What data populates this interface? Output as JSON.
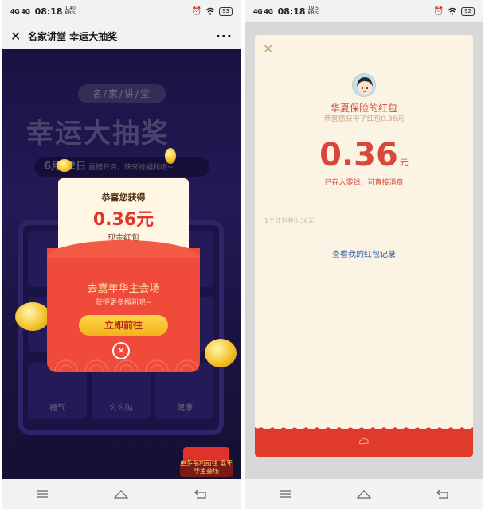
{
  "left": {
    "status": {
      "signal": "4G 4G",
      "time": "08:18",
      "speed_top": "1.40",
      "speed_bottom": "KB/s",
      "battery": "93"
    },
    "titlebar": {
      "title": "名家讲堂 幸运大抽奖"
    },
    "background": {
      "subtitle": "名/家/讲/堂",
      "title": "幸运大抽奖",
      "date_big": "6月22日",
      "date_text": "重磅开启，快来抢福利吧~",
      "cells": [
        "福气",
        "么么哒",
        "健康"
      ],
      "corner_promo": "更多福利前往 嘉年华主会场"
    },
    "popup": {
      "congrats": "恭喜您获得",
      "amount": "0.36元",
      "type": "现金红包",
      "goto": "去嘉年华主会场",
      "more": "获得更多福利吧~",
      "button": "立即前往"
    }
  },
  "right": {
    "status": {
      "signal": "4G 4G",
      "time": "08:18",
      "speed_top": "19.5",
      "speed_bottom": "KB/s",
      "battery": "92"
    },
    "card": {
      "sender": "华夏保险的红包",
      "note": "恭喜您获得了红包0.36元",
      "amount": "0.36",
      "unit": "元",
      "deposit": "已存入零钱，可直接消费",
      "count": "1个红包共0.36元",
      "record_link": "查看我的红包记录"
    }
  },
  "colors": {
    "red": "#e03a2c",
    "gold": "#f4b21b",
    "purple": "#3b2a8c",
    "cream": "#fbf3e4",
    "link": "#2b5aa0"
  },
  "icons": [
    "close-icon",
    "more-icon",
    "alarm-icon",
    "wifi-icon",
    "battery-icon",
    "menu-icon",
    "home-icon",
    "back-icon",
    "avatar-icon"
  ]
}
